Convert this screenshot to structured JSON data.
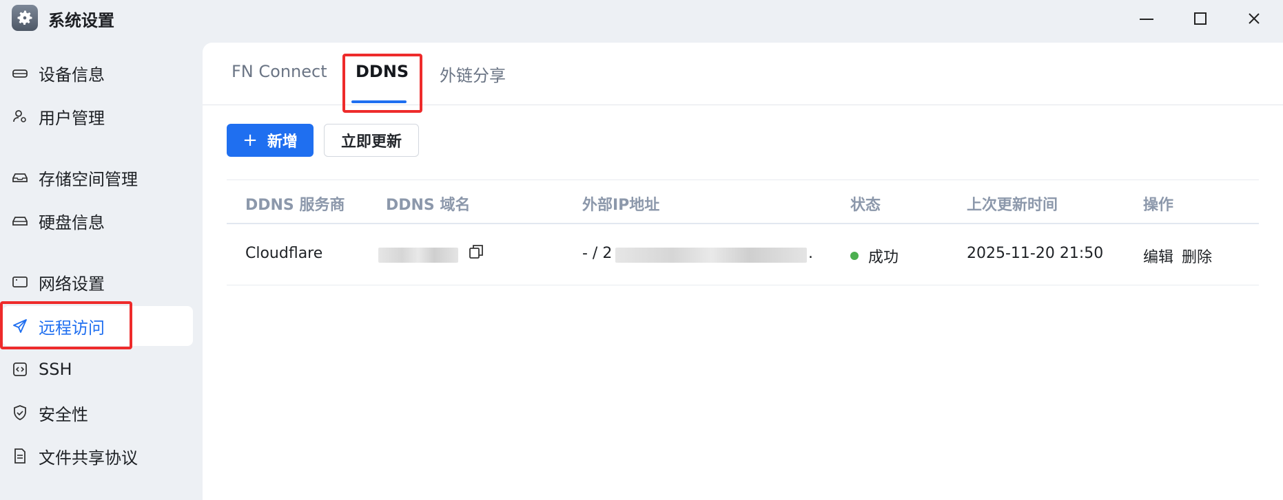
{
  "app": {
    "title": "系统设置",
    "icon": "gear-icon"
  },
  "window_controls": {
    "minimize_icon": "minimize-icon",
    "maximize_icon": "maximize-icon",
    "close_icon": "close-icon"
  },
  "sidebar": {
    "items": [
      {
        "label": "设备信息",
        "icon": "drive-icon"
      },
      {
        "label": "用户管理",
        "icon": "user-settings-icon"
      },
      {
        "label": "存储空间管理",
        "icon": "storage-icon"
      },
      {
        "label": "硬盘信息",
        "icon": "disk-icon"
      },
      {
        "label": "网络设置",
        "icon": "network-icon"
      },
      {
        "label": "远程访问",
        "icon": "paper-plane-icon",
        "active": true
      },
      {
        "label": "SSH",
        "icon": "terminal-icon"
      },
      {
        "label": "安全性",
        "icon": "shield-icon"
      },
      {
        "label": "文件共享协议",
        "icon": "document-icon"
      }
    ]
  },
  "tabs": [
    {
      "label": "FN Connect"
    },
    {
      "label": "DDNS",
      "active": true
    },
    {
      "label": "外链分享"
    }
  ],
  "toolbar": {
    "add_label": "新增",
    "update_label": "立即更新"
  },
  "table": {
    "columns": [
      "DDNS 服务商",
      "DDNS 域名",
      "外部IP地址",
      "状态",
      "上次更新时间",
      "操作"
    ],
    "rows": [
      {
        "provider": "Cloudflare",
        "ip_prefix": "- / 2",
        "ip_suffix": ".",
        "status": "成功",
        "updated": "2025-11-20 21:50",
        "actions": [
          "编辑",
          "删除"
        ]
      }
    ]
  },
  "colors": {
    "accent": "#1f6ff0",
    "highlight": "#ee2b2b",
    "success": "#4caf50"
  }
}
